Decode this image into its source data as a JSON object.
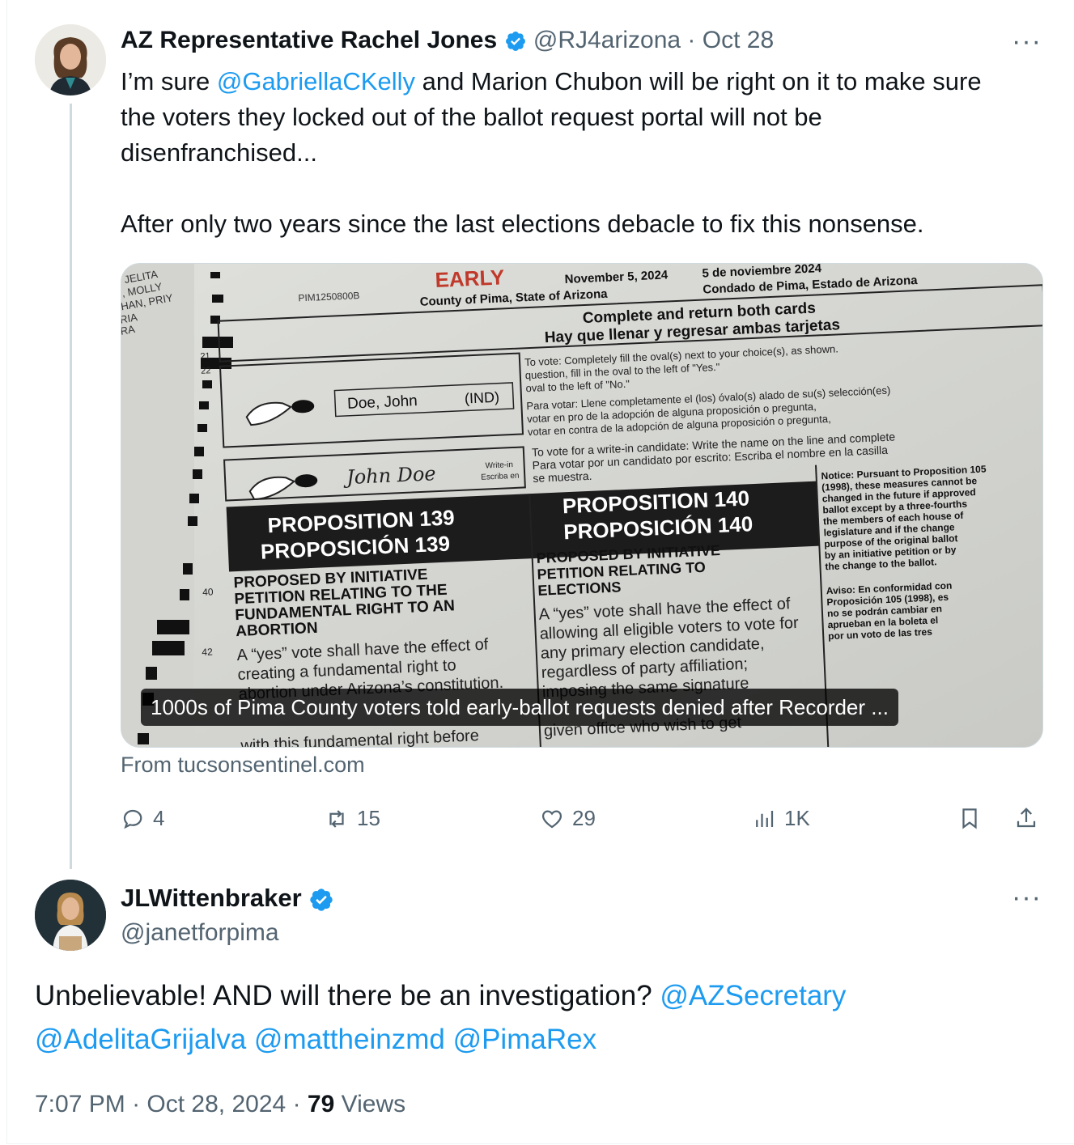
{
  "tweet1": {
    "name": "AZ Representative Rachel Jones",
    "handle": "@RJ4arizona",
    "date": "Oct 28",
    "separator": "·",
    "more": "···",
    "body_parts": {
      "p1_pre": "I’m sure ",
      "p1_mention": "@GabriellaCKelly",
      "p1_post": " and Marion Chubon will be right on it to make sure the voters they locked out of the ballot request portal will not be disenfranchised...",
      "p2": "After only two years since the last elections debacle to fix this nonsense."
    },
    "card": {
      "caption": "1000s of Pima County voters told early-ballot requests denied after Recorder ...",
      "source": "From tucsonsentinel.com",
      "image_text": {
        "code": "PIM1250800B",
        "early": "EARLY",
        "date_en": "November 5, 2024",
        "date_es": "5 de noviembre 2024",
        "county_en": "County of Pima, State of Arizona",
        "county_es": "Condado de Pima, Estado de Arizona",
        "instr_en": "Complete and return both cards",
        "instr_es": "Hay que llenar y regresar ambas tarjetas",
        "cand1": "Doe, John",
        "cand1_party": "(IND)",
        "cand2": "John Doe",
        "writein": "Write-in",
        "writein_es": "Escriba en",
        "prop139": "PROPOSITION 139",
        "prop139_es": "PROPOSICIÓN 139",
        "prop140": "PROPOSITION 140",
        "prop140_es": "PROPOSICIÓN 140",
        "prop139_desc": "PROPOSED BY INITIATIVE PETITION RELATING TO THE FUNDAMENTAL RIGHT TO AN ABORTION",
        "prop140_desc": "PROPOSED BY INITIATIVE PETITION RELATING TO ELECTIONS",
        "prop139_text": "A “yes” vote shall have the effect of creating a fundamental right to abortion under Arizona’s constitution.",
        "prop140_text": "A “yes” vote shall have the effect of allowing all eligible voters to vote for any primary election candidate, regardless of party affiliation;",
        "notice": "Notice: Pursuant to Proposition 105 (1998), these measures cannot be changed in the future if approved",
        "aviso": "Aviso: En conformidad con Proposición 105 (1998),",
        "line21": "21",
        "line22": "22",
        "line40": "40",
        "line42": "42"
      }
    },
    "actions": {
      "replies": "4",
      "reposts": "15",
      "likes": "29",
      "views": "1K"
    }
  },
  "tweet2": {
    "name": "JLWittenbraker",
    "handle": "@janetforpima",
    "more": "···",
    "body_text": "Unbelievable! AND will there be an investigation? ",
    "mentions": [
      "@AZSecretary",
      "@AdelitaGrijalva",
      "@mattheinzmd",
      "@PimaRex"
    ],
    "time": "7:07 PM",
    "date": "Oct 28, 2024",
    "separator": "·",
    "views_count": "79",
    "views_label": "Views"
  },
  "colors": {
    "link": "#1d9bf0",
    "muted": "#536471",
    "text": "#0f1419",
    "thread": "#cfd9de"
  }
}
